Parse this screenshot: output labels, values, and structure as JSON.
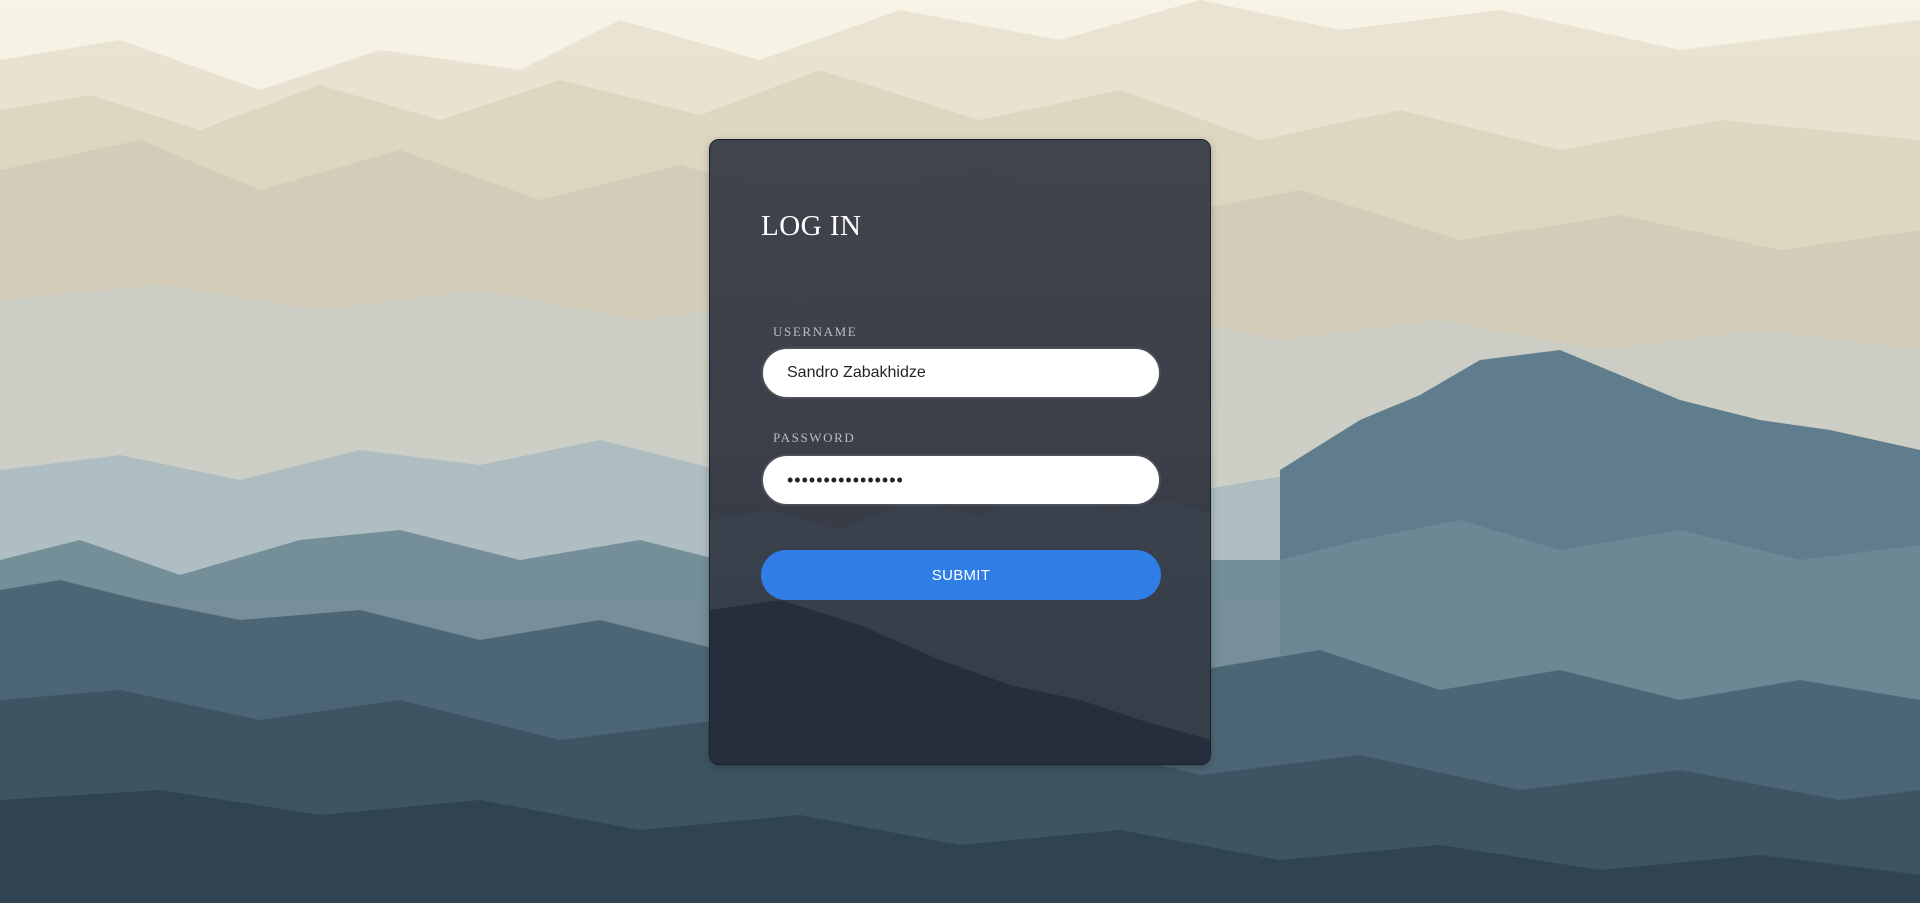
{
  "login": {
    "title": "LOG IN",
    "username_label": "USERNAME",
    "username_value": "Sandro Zabakhidze",
    "password_label": "PASSWORD",
    "password_value": "••••••••••••••••",
    "submit_label": "SUBMIT"
  },
  "colors": {
    "card_background": "#3a3e48",
    "submit_button": "#2f7de6",
    "input_background": "#ffffff",
    "label_text": "#b9bcc3"
  }
}
